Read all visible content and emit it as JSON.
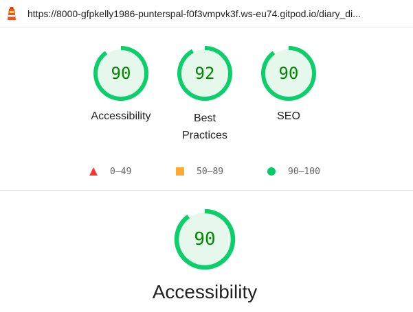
{
  "browser": {
    "url": "https://8000-gfpkelly1986-punterspal-f0f3vmpvk3f.ws-eu74.gitpod.io/diary_di..."
  },
  "gauges": [
    {
      "label": "Accessibility",
      "score": "90",
      "fraction": 0.9
    },
    {
      "label_line1": "Best",
      "label_line2": "Practices",
      "score": "92",
      "fraction": 0.92
    },
    {
      "label": "SEO",
      "score": "90",
      "fraction": 0.9
    }
  ],
  "legend": {
    "fail": "0–49",
    "average": "50–89",
    "pass": "90–100"
  },
  "category": {
    "title": "Accessibility",
    "score": "90",
    "fraction": 0.9
  },
  "colors": {
    "pass_ring": "#0cce6b",
    "pass_fill": "#e6f8ec",
    "pass_text": "#008800",
    "fail": "#ff3333",
    "average": "#ffaa33"
  }
}
